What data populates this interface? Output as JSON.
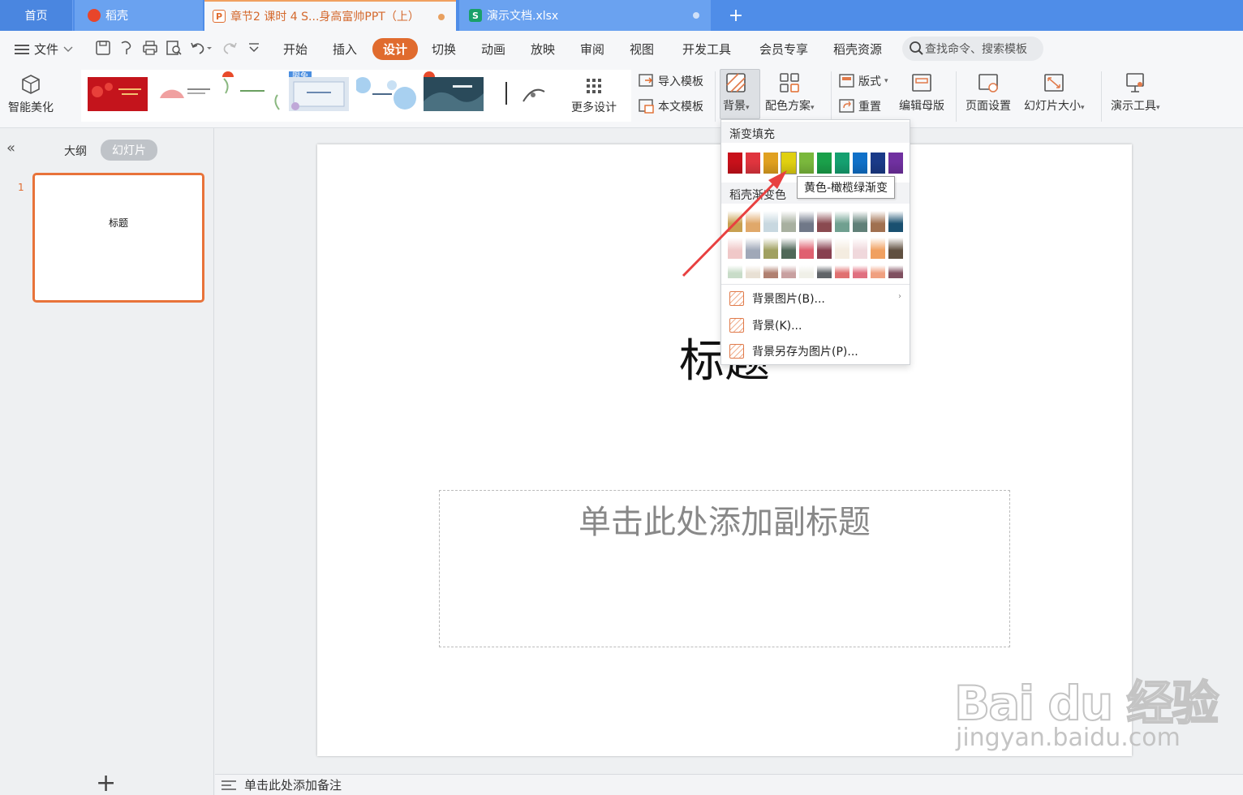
{
  "tabs": {
    "home": "首页",
    "daoke": "稻壳",
    "ppt": "章节2 课时 4 S...身高富帅PPT（上）",
    "xls": "演示文档.xlsx",
    "add": "+"
  },
  "menu": {
    "file": "文件",
    "items": [
      "开始",
      "插入",
      "设计",
      "切换",
      "动画",
      "放映",
      "审阅",
      "视图",
      "开发工具",
      "会员专享",
      "稻壳资源"
    ],
    "active": "设计",
    "search_placeholder": "查找命令、搜索模板"
  },
  "ribbon": {
    "smart_beautify": "智能美化",
    "more_designs": "更多设计",
    "limited_badge": "限免",
    "import_template": "导入模板",
    "this_template": "本文模板",
    "background": "背景",
    "color_scheme": "配色方案",
    "layout": "版式",
    "reset": "重置",
    "edit_master": "编辑母版",
    "page_setup": "页面设置",
    "slide_size": "幻灯片大小",
    "presentation_tools": "演示工具"
  },
  "left_panel": {
    "outline": "大纲",
    "slides": "幻灯片",
    "slide_number": "1",
    "thumb_title": "标题",
    "add": "+"
  },
  "slide": {
    "title": "标题",
    "subtitle_placeholder": "单击此处添加副标题"
  },
  "notes_placeholder": "单击此处添加备注",
  "dropdown": {
    "gradient_fill": "渐变填充",
    "daoke_gradient": "稻壳渐变色",
    "gradient_colors": [
      "#c8101a",
      "#e0353e",
      "#e0a020",
      "#e0d010",
      "#7ab83c",
      "#1aa04a",
      "#15a070",
      "#1070c8",
      "#1a3a88",
      "#7030a0"
    ],
    "preset_rows": [
      [
        "#c8a050",
        "#e0a86a",
        "#c8d8e0",
        "#a8b0a0",
        "#707888",
        "#8a4a50",
        "#70a090",
        "#608078",
        "#a07050",
        "#1a5070"
      ],
      [
        "#f0c8c8",
        "#a0a8b8",
        "#a0a060",
        "#506858",
        "#e06070",
        "#884050",
        "#f4ece0",
        "#f0d8dc",
        "#f0a060",
        "#605040"
      ],
      [
        "#c8dcc8",
        "#e8e0d4",
        "#b08070",
        "#c8a0a0",
        "#f0f0e8",
        "#606468",
        "#e07070",
        "#e07080",
        "#f0a080",
        "#805060"
      ]
    ],
    "items": [
      "背景图片(B)...",
      "背景(K)...",
      "背景另存为图片(P)..."
    ],
    "tooltip": "黄色-橄榄绿渐变"
  },
  "watermark": {
    "logo": "Bai du 经验",
    "url": "jingyan.baidu.com"
  },
  "colors": {
    "accent": "#e06b2e",
    "tabbar": "#4f8de8",
    "arrow": "#e84040"
  }
}
